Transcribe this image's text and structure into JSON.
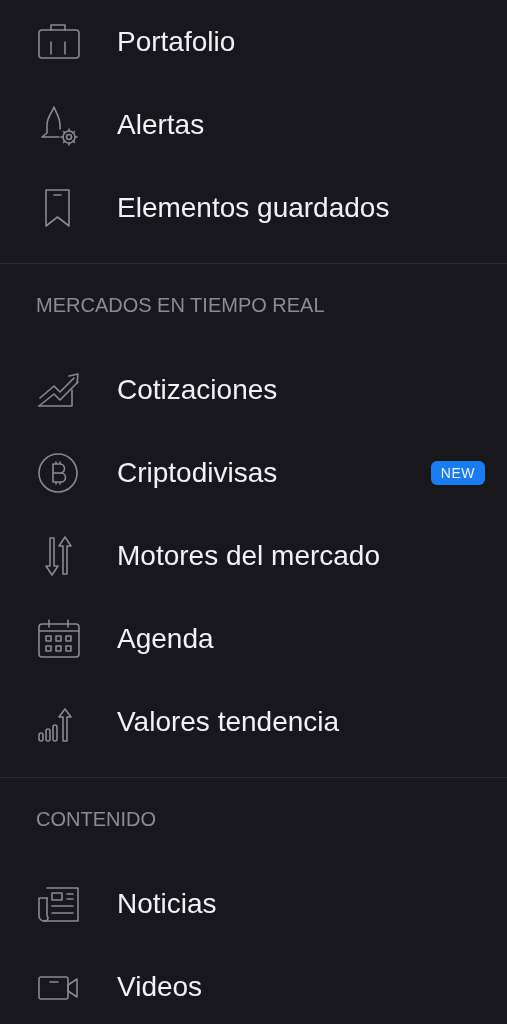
{
  "sections": [
    {
      "items": [
        {
          "label": "Portafolio"
        },
        {
          "label": "Alertas"
        },
        {
          "label": "Elementos guardados"
        }
      ]
    },
    {
      "header": "MERCADOS EN TIEMPO REAL",
      "items": [
        {
          "label": "Cotizaciones"
        },
        {
          "label": "Criptodivisas",
          "badge": "NEW"
        },
        {
          "label": "Motores del mercado"
        },
        {
          "label": "Agenda"
        },
        {
          "label": "Valores tendencia"
        }
      ]
    },
    {
      "header": "CONTENIDO",
      "items": [
        {
          "label": "Noticias"
        },
        {
          "label": "Videos"
        }
      ]
    }
  ]
}
